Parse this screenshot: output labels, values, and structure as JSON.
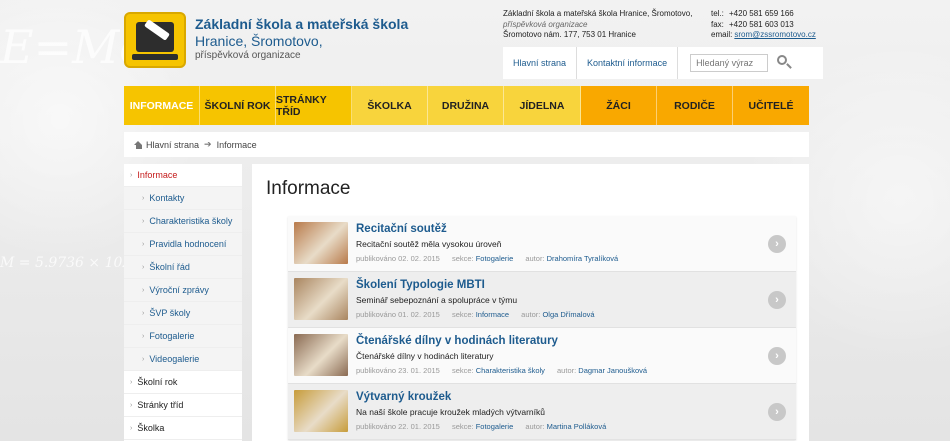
{
  "school": {
    "name_line1": "Základní škola a mateřská škola",
    "name_line2": "Hranice, Šromotovo,",
    "name_line3": "příspěvková organizace"
  },
  "contact": {
    "line1": "Základní škola a mateřská škola Hranice, Šromotovo,",
    "line2": "příspěvková organizace",
    "line3": "Šromotovo nám. 177, 753 01 Hranice",
    "tel_label": "tel.:",
    "tel": "+420 581 659 166",
    "fax_label": "fax:",
    "fax": "+420 581 603 013",
    "email_label": "email:",
    "email": "srom@zssromotovo.cz"
  },
  "topnav": {
    "home": "Hlavní strana",
    "contact": "Kontaktní informace",
    "search_placeholder": "Hledaný výraz"
  },
  "mainmenu": [
    {
      "label": "Informace"
    },
    {
      "label": "Školní rok"
    },
    {
      "label": "Stránky tříd"
    },
    {
      "label": "Školka"
    },
    {
      "label": "Družina"
    },
    {
      "label": "Jídelna"
    },
    {
      "label": "Žáci"
    },
    {
      "label": "Rodiče"
    },
    {
      "label": "Učitelé"
    }
  ],
  "breadcrumb": {
    "home": "Hlavní strana",
    "current": "Informace"
  },
  "sidebar": {
    "items": [
      {
        "label": "Informace"
      },
      {
        "label": "Kontakty"
      },
      {
        "label": "Charakteristika školy"
      },
      {
        "label": "Pravidla hodnocení"
      },
      {
        "label": "Školní řád"
      },
      {
        "label": "Výroční zprávy"
      },
      {
        "label": "ŠVP školy"
      },
      {
        "label": "Fotogalerie"
      },
      {
        "label": "Videogalerie"
      },
      {
        "label": "Školní rok"
      },
      {
        "label": "Stránky tříd"
      },
      {
        "label": "Školka"
      }
    ]
  },
  "page": {
    "title": "Informace"
  },
  "meta_labels": {
    "published": "publikováno",
    "section": "sekce:",
    "author": "autor:"
  },
  "articles": [
    {
      "title": "Recitační soutěž",
      "perex": "Recitační soutěž měla vysokou úroveň",
      "date": "02. 02. 2015",
      "section": "Fotogalerie",
      "author": "Drahomíra Tyralíková",
      "thumb_color": "#b87a4a"
    },
    {
      "title": "Školení Typologie MBTI",
      "perex": "Seminář sebepoznání a spolupráce v týmu",
      "date": "01. 02. 2015",
      "section": "Informace",
      "author": "Olga Dřímalová",
      "thumb_color": "#a9855f"
    },
    {
      "title": "Čtenářské dílny v hodinách literatury",
      "perex": "Čtenářské dílny v hodinách literatury",
      "date": "23. 01. 2015",
      "section": "Charakteristika školy",
      "author": "Dagmar Janoušková",
      "thumb_color": "#8a6a52"
    },
    {
      "title": "Výtvarný kroužek",
      "perex": "Na naší škole pracuje kroužek mladých výtvarníků",
      "date": "22. 01. 2015",
      "section": "Fotogalerie",
      "author": "Martina Polláková",
      "thumb_color": "#c79c3a"
    }
  ]
}
